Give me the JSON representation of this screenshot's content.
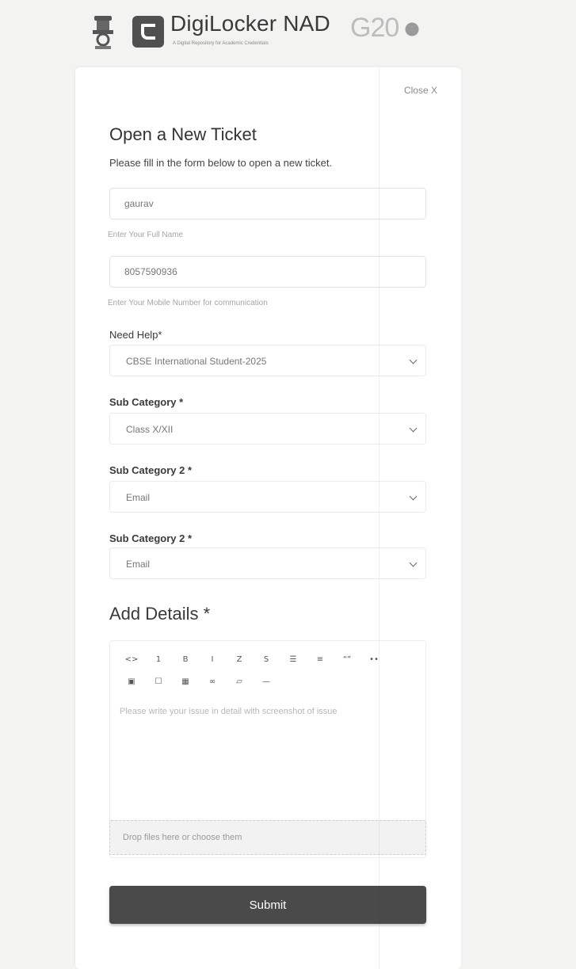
{
  "header": {
    "brand_name": "DigiLocker NAD",
    "brand_tagline": "A Digital Repository for Academic Credentials",
    "g20_text": "G20",
    "emblem_icon": "national-emblem-icon",
    "logo_icon": "digilocker-logo-icon"
  },
  "form": {
    "close_label": "Close X",
    "title": "Open a New Ticket",
    "subtitle": "Please fill in the form below to open a new ticket.",
    "name": {
      "value": "gaurav",
      "hint": "Enter Your Full Name"
    },
    "mobile": {
      "value": "8057590936",
      "hint": "Enter Your Mobile Number for communication"
    },
    "need_help": {
      "label": "Need Help*",
      "selected": "CBSE International Student-2025"
    },
    "sub_category": {
      "label": "Sub Category *",
      "selected": "Class X/XII"
    },
    "sub_category_2a": {
      "label": "Sub Category 2 *",
      "selected": "Email"
    },
    "sub_category_2b": {
      "label": "Sub Category 2 *",
      "selected": "Email"
    },
    "details": {
      "title": "Add Details *",
      "placeholder": "Please write your issue in detail with screenshot of issue",
      "toolbar_row1": [
        "<>",
        "1",
        "B",
        "I",
        "Z",
        "S",
        "☰",
        "≡",
        "“”",
        "••"
      ],
      "toolbar_row2": [
        "▣",
        "☐",
        "▦",
        "∞",
        "▱",
        "—"
      ]
    },
    "dropzone_text": "Drop files here or choose them",
    "submit_label": "Submit"
  },
  "colors": {
    "background": "#f4f4f3",
    "card": "#ffffff",
    "submit_bg": "#4a4a4a"
  }
}
